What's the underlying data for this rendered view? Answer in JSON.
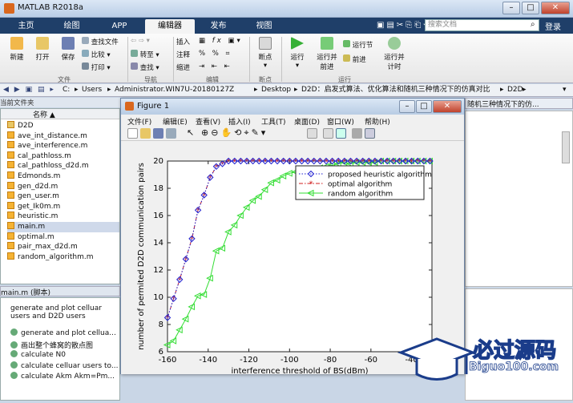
{
  "window": {
    "title": "MATLAB R2018a"
  },
  "ribbon_tabs": [
    "主页",
    "绘图",
    "APP",
    "编辑器",
    "发布",
    "视图"
  ],
  "search": {
    "placeholder": "搜索文档",
    "login": "登录"
  },
  "ribbon": {
    "file_group": {
      "label": "文件",
      "new": "新建",
      "open": "打开",
      "save": "保存",
      "find_files": "查找文件",
      "compare": "比较",
      "print": "打印"
    },
    "nav_group": {
      "label": "导航",
      "goto": "转至",
      "find": "查找"
    },
    "edit_group": {
      "label": "编辑",
      "insert": "插入",
      "comment": "注释",
      "indent": "缩进"
    },
    "breakpoint_group": {
      "label": "断点",
      "breakpoints": "断点"
    },
    "run_group": {
      "label": "运行",
      "run": "运行",
      "run_advance": "运行并\n前进",
      "run_section": "运行节",
      "advance": "前进",
      "run_time": "运行并\n计时"
    }
  },
  "address": {
    "path": [
      "C:",
      "Users",
      "Administrator.WIN7U-20180127Z",
      "Desktop",
      "D2D：启发式算法、优化算法和随机三种情况下的仿真对比",
      "D2D"
    ]
  },
  "current_folder": {
    "title": "当前文件夹",
    "column": "名称 ▲",
    "items": [
      {
        "name": "D2D",
        "type": "folder"
      },
      {
        "name": "ave_int_distance.m"
      },
      {
        "name": "ave_interference.m"
      },
      {
        "name": "cal_pathloss.m"
      },
      {
        "name": "cal_pathloss_d2d.m"
      },
      {
        "name": "Edmonds.m"
      },
      {
        "name": "gen_d2d.m"
      },
      {
        "name": "gen_user.m"
      },
      {
        "name": "get_Ik0m.m"
      },
      {
        "name": "heuristic.m"
      },
      {
        "name": "main.m",
        "selected": true
      },
      {
        "name": "optimal.m"
      },
      {
        "name": "pair_max_d2d.m"
      },
      {
        "name": "random_algorithm.m"
      }
    ]
  },
  "details": {
    "title": "main.m  (脚本)",
    "description": "generate and plot celluar users and D2D users",
    "items": [
      "generate and plot cellua...",
      "画出整个蜂窝的散点图",
      "calculate N0",
      "calculate celluar users to...",
      "calculate Akm  Akm=Pm..."
    ]
  },
  "editor_header": "随机三种情况下的仿...",
  "figure": {
    "title": "Figure 1",
    "menu": [
      "文件(F)",
      "编辑(E)",
      "查看(V)",
      "插入(I)",
      "工具(T)",
      "桌面(D)",
      "窗口(W)",
      "帮助(H)"
    ]
  },
  "chart_data": {
    "type": "line",
    "xlabel": "interference threshold of BS(dBm)",
    "ylabel": "number of permited D2D communication pairs",
    "xlim": [
      -160,
      -30
    ],
    "ylim": [
      6,
      20
    ],
    "xticks": [
      -160,
      -140,
      -120,
      -100,
      -80,
      -60,
      -40
    ],
    "yticks": [
      6,
      8,
      10,
      12,
      14,
      16,
      18,
      20
    ],
    "legend_position": "top-right",
    "x": [
      -160,
      -157,
      -154,
      -151,
      -148,
      -145,
      -142,
      -139,
      -136,
      -133,
      -130,
      -127,
      -124,
      -121,
      -118,
      -115,
      -112,
      -109,
      -106,
      -103,
      -100,
      -97,
      -94,
      -91,
      -88,
      -85,
      -82,
      -79,
      -76,
      -73,
      -70,
      -67,
      -64,
      -61,
      -58,
      -55,
      -52,
      -49,
      -46,
      -43,
      -40,
      -37,
      -34,
      -31
    ],
    "series": [
      {
        "name": "proposed heuristic algorithm",
        "color": "#1f1fd0",
        "style": "dotted",
        "marker": "diamond",
        "values": [
          8.5,
          9.9,
          11.3,
          12.8,
          14.3,
          16.4,
          17.5,
          18.8,
          19.6,
          19.8,
          20,
          20,
          20,
          20,
          20,
          20,
          20,
          20,
          20,
          20,
          20,
          20,
          20,
          20,
          20,
          20,
          20,
          20,
          20,
          20,
          20,
          20,
          20,
          20,
          20,
          20,
          20,
          20,
          20,
          20,
          20,
          20,
          20,
          20
        ]
      },
      {
        "name": "optimal algorithm",
        "color": "#d01f1f",
        "style": "dashdot",
        "marker": "star",
        "values": [
          8.5,
          9.9,
          11.3,
          12.8,
          14.3,
          16.4,
          17.5,
          18.8,
          19.6,
          19.8,
          20,
          20,
          20,
          20,
          20,
          20,
          20,
          20,
          20,
          20,
          20,
          20,
          20,
          20,
          20,
          20,
          20,
          20,
          20,
          20,
          20,
          20,
          20,
          20,
          20,
          20,
          20,
          20,
          20,
          20,
          20,
          20,
          20,
          20
        ]
      },
      {
        "name": "random algorithm",
        "color": "#33dd33",
        "style": "solid",
        "marker": "triangle-left",
        "values": [
          6.5,
          6.8,
          7.6,
          8.4,
          9.3,
          10.1,
          10.2,
          11.4,
          13.4,
          13.6,
          14.8,
          15.3,
          16.0,
          16.6,
          17.1,
          17.4,
          17.9,
          18.4,
          18.6,
          18.9,
          19.1,
          19.2,
          19.4,
          19.4,
          19.4,
          19.5,
          19.6,
          19.7,
          19.8,
          19.9,
          19.8,
          19.9,
          19.9,
          19.9,
          19.9,
          20,
          20,
          20,
          20,
          20,
          20,
          20,
          20,
          20
        ]
      }
    ]
  },
  "watermark": {
    "text": "必过源码",
    "url": "Biguo100.com"
  }
}
